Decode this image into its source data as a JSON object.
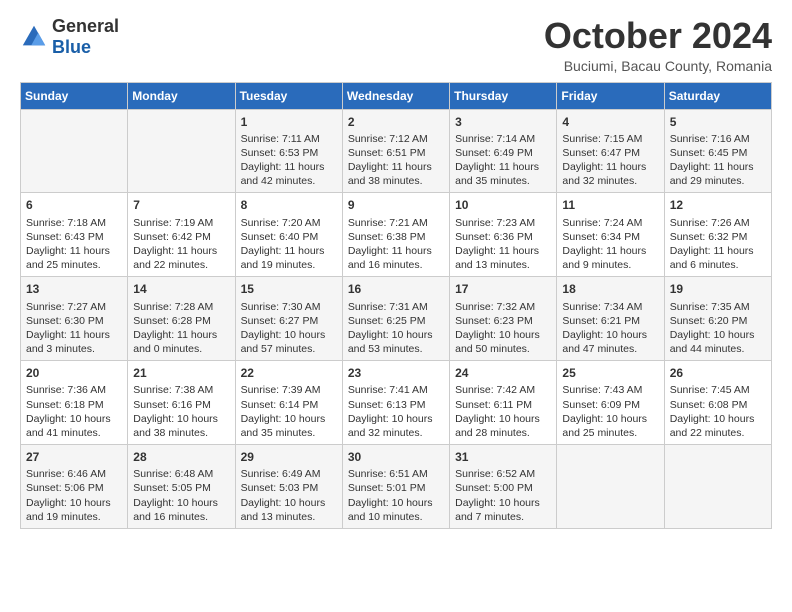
{
  "logo": {
    "general": "General",
    "blue": "Blue"
  },
  "header": {
    "month": "October 2024",
    "location": "Buciumi, Bacau County, Romania"
  },
  "days_of_week": [
    "Sunday",
    "Monday",
    "Tuesday",
    "Wednesday",
    "Thursday",
    "Friday",
    "Saturday"
  ],
  "weeks": [
    [
      {
        "day": "",
        "sunrise": "",
        "sunset": "",
        "daylight": ""
      },
      {
        "day": "",
        "sunrise": "",
        "sunset": "",
        "daylight": ""
      },
      {
        "day": "1",
        "sunrise": "Sunrise: 7:11 AM",
        "sunset": "Sunset: 6:53 PM",
        "daylight": "Daylight: 11 hours and 42 minutes."
      },
      {
        "day": "2",
        "sunrise": "Sunrise: 7:12 AM",
        "sunset": "Sunset: 6:51 PM",
        "daylight": "Daylight: 11 hours and 38 minutes."
      },
      {
        "day": "3",
        "sunrise": "Sunrise: 7:14 AM",
        "sunset": "Sunset: 6:49 PM",
        "daylight": "Daylight: 11 hours and 35 minutes."
      },
      {
        "day": "4",
        "sunrise": "Sunrise: 7:15 AM",
        "sunset": "Sunset: 6:47 PM",
        "daylight": "Daylight: 11 hours and 32 minutes."
      },
      {
        "day": "5",
        "sunrise": "Sunrise: 7:16 AM",
        "sunset": "Sunset: 6:45 PM",
        "daylight": "Daylight: 11 hours and 29 minutes."
      }
    ],
    [
      {
        "day": "6",
        "sunrise": "Sunrise: 7:18 AM",
        "sunset": "Sunset: 6:43 PM",
        "daylight": "Daylight: 11 hours and 25 minutes."
      },
      {
        "day": "7",
        "sunrise": "Sunrise: 7:19 AM",
        "sunset": "Sunset: 6:42 PM",
        "daylight": "Daylight: 11 hours and 22 minutes."
      },
      {
        "day": "8",
        "sunrise": "Sunrise: 7:20 AM",
        "sunset": "Sunset: 6:40 PM",
        "daylight": "Daylight: 11 hours and 19 minutes."
      },
      {
        "day": "9",
        "sunrise": "Sunrise: 7:21 AM",
        "sunset": "Sunset: 6:38 PM",
        "daylight": "Daylight: 11 hours and 16 minutes."
      },
      {
        "day": "10",
        "sunrise": "Sunrise: 7:23 AM",
        "sunset": "Sunset: 6:36 PM",
        "daylight": "Daylight: 11 hours and 13 minutes."
      },
      {
        "day": "11",
        "sunrise": "Sunrise: 7:24 AM",
        "sunset": "Sunset: 6:34 PM",
        "daylight": "Daylight: 11 hours and 9 minutes."
      },
      {
        "day": "12",
        "sunrise": "Sunrise: 7:26 AM",
        "sunset": "Sunset: 6:32 PM",
        "daylight": "Daylight: 11 hours and 6 minutes."
      }
    ],
    [
      {
        "day": "13",
        "sunrise": "Sunrise: 7:27 AM",
        "sunset": "Sunset: 6:30 PM",
        "daylight": "Daylight: 11 hours and 3 minutes."
      },
      {
        "day": "14",
        "sunrise": "Sunrise: 7:28 AM",
        "sunset": "Sunset: 6:28 PM",
        "daylight": "Daylight: 11 hours and 0 minutes."
      },
      {
        "day": "15",
        "sunrise": "Sunrise: 7:30 AM",
        "sunset": "Sunset: 6:27 PM",
        "daylight": "Daylight: 10 hours and 57 minutes."
      },
      {
        "day": "16",
        "sunrise": "Sunrise: 7:31 AM",
        "sunset": "Sunset: 6:25 PM",
        "daylight": "Daylight: 10 hours and 53 minutes."
      },
      {
        "day": "17",
        "sunrise": "Sunrise: 7:32 AM",
        "sunset": "Sunset: 6:23 PM",
        "daylight": "Daylight: 10 hours and 50 minutes."
      },
      {
        "day": "18",
        "sunrise": "Sunrise: 7:34 AM",
        "sunset": "Sunset: 6:21 PM",
        "daylight": "Daylight: 10 hours and 47 minutes."
      },
      {
        "day": "19",
        "sunrise": "Sunrise: 7:35 AM",
        "sunset": "Sunset: 6:20 PM",
        "daylight": "Daylight: 10 hours and 44 minutes."
      }
    ],
    [
      {
        "day": "20",
        "sunrise": "Sunrise: 7:36 AM",
        "sunset": "Sunset: 6:18 PM",
        "daylight": "Daylight: 10 hours and 41 minutes."
      },
      {
        "day": "21",
        "sunrise": "Sunrise: 7:38 AM",
        "sunset": "Sunset: 6:16 PM",
        "daylight": "Daylight: 10 hours and 38 minutes."
      },
      {
        "day": "22",
        "sunrise": "Sunrise: 7:39 AM",
        "sunset": "Sunset: 6:14 PM",
        "daylight": "Daylight: 10 hours and 35 minutes."
      },
      {
        "day": "23",
        "sunrise": "Sunrise: 7:41 AM",
        "sunset": "Sunset: 6:13 PM",
        "daylight": "Daylight: 10 hours and 32 minutes."
      },
      {
        "day": "24",
        "sunrise": "Sunrise: 7:42 AM",
        "sunset": "Sunset: 6:11 PM",
        "daylight": "Daylight: 10 hours and 28 minutes."
      },
      {
        "day": "25",
        "sunrise": "Sunrise: 7:43 AM",
        "sunset": "Sunset: 6:09 PM",
        "daylight": "Daylight: 10 hours and 25 minutes."
      },
      {
        "day": "26",
        "sunrise": "Sunrise: 7:45 AM",
        "sunset": "Sunset: 6:08 PM",
        "daylight": "Daylight: 10 hours and 22 minutes."
      }
    ],
    [
      {
        "day": "27",
        "sunrise": "Sunrise: 6:46 AM",
        "sunset": "Sunset: 5:06 PM",
        "daylight": "Daylight: 10 hours and 19 minutes."
      },
      {
        "day": "28",
        "sunrise": "Sunrise: 6:48 AM",
        "sunset": "Sunset: 5:05 PM",
        "daylight": "Daylight: 10 hours and 16 minutes."
      },
      {
        "day": "29",
        "sunrise": "Sunrise: 6:49 AM",
        "sunset": "Sunset: 5:03 PM",
        "daylight": "Daylight: 10 hours and 13 minutes."
      },
      {
        "day": "30",
        "sunrise": "Sunrise: 6:51 AM",
        "sunset": "Sunset: 5:01 PM",
        "daylight": "Daylight: 10 hours and 10 minutes."
      },
      {
        "day": "31",
        "sunrise": "Sunrise: 6:52 AM",
        "sunset": "Sunset: 5:00 PM",
        "daylight": "Daylight: 10 hours and 7 minutes."
      },
      {
        "day": "",
        "sunrise": "",
        "sunset": "",
        "daylight": ""
      },
      {
        "day": "",
        "sunrise": "",
        "sunset": "",
        "daylight": ""
      }
    ]
  ]
}
